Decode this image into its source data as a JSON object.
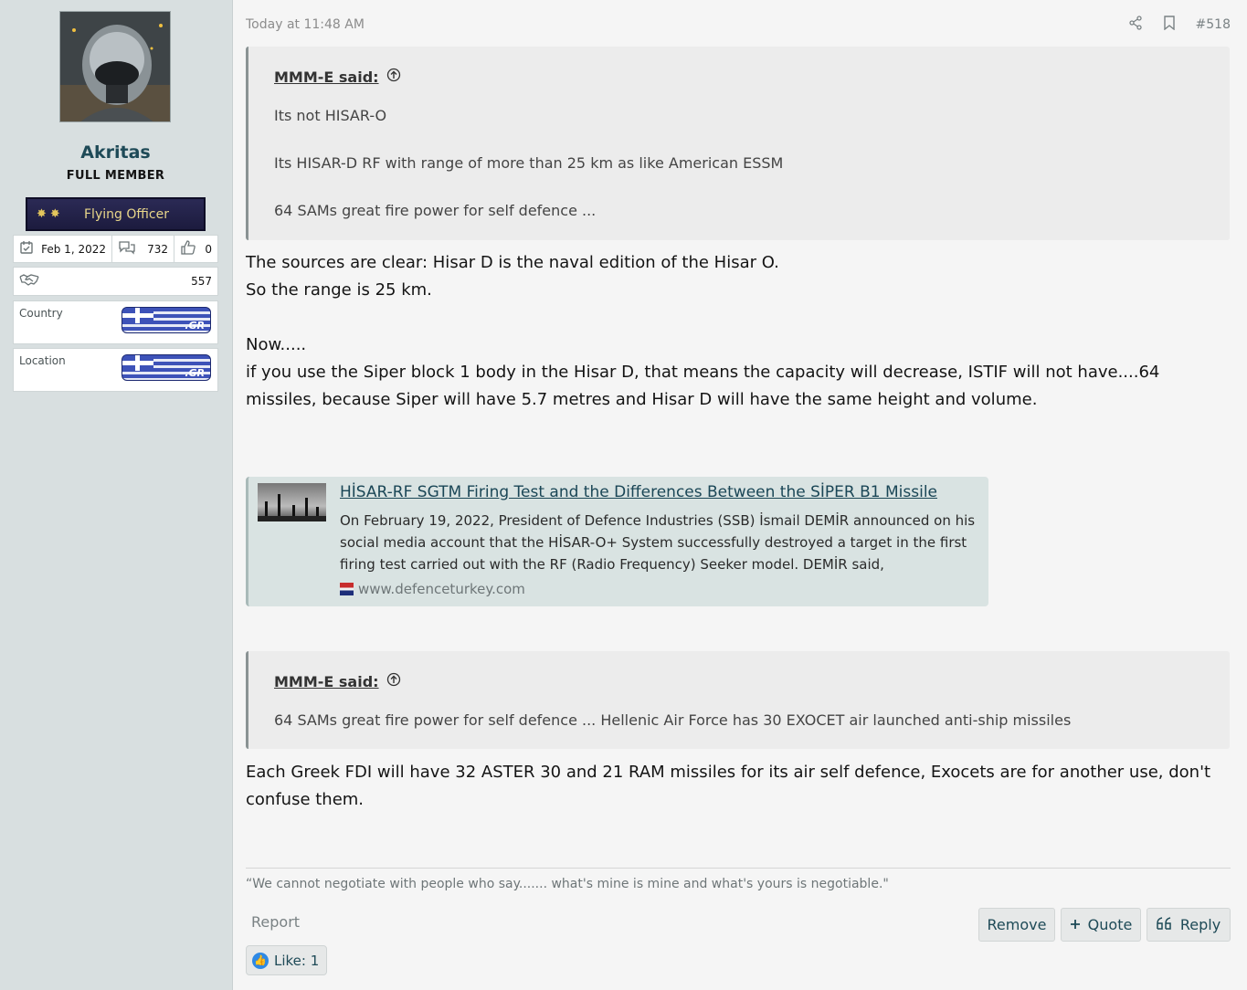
{
  "user": {
    "username": "Akritas",
    "title": "FULL MEMBER",
    "rank": "Flying Officer",
    "joined": "Feb 1, 2022",
    "messages": "732",
    "reactions": "0",
    "points": "557",
    "country_label": "Country",
    "location_label": "Location",
    "country_flag_text": ".GR",
    "location_flag_text": ".GR"
  },
  "post": {
    "time": "Today at 11:48 AM",
    "number": "#518"
  },
  "quote1": {
    "author": "MMM-E said:",
    "lines": [
      "Its not HISAR-O",
      "Its HISAR-D RF with range of more than 25 km as like American ESSM",
      "64 SAMs great fire power for self defence ..."
    ]
  },
  "body1": [
    "The sources are clear: Hisar D is the naval edition of the Hisar O.",
    "So the range is 25 km.",
    "Now.....",
    "if you use the Siper block 1 body in the Hisar D, that means the capacity will decrease, ISTIF will not have....64 missiles, because Siper will have 5.7 metres and Hisar D will have the same height and volume."
  ],
  "link_card": {
    "title": "HİSAR-RF SGTM Firing Test and the Differences Between the SİPER B1 Missile",
    "description": "On February 19, 2022, President of Defence Industries (SSB) İsmail DEMİR announced on his social media account that the HİSAR-O+ System successfully destroyed a target in the first firing test carried out with the RF (Radio Frequency) Seeker model. DEMİR said,",
    "domain": "www.defenceturkey.com"
  },
  "quote2": {
    "author": "MMM-E said:",
    "lines": [
      "64 SAMs great fire power for self defence ... Hellenic Air Force has 30 EXOCET air launched anti-ship missiles"
    ]
  },
  "body2": "Each Greek FDI will have 32 ASTER 30 and 21 RAM missiles for its air self defence, Exocets are for another use, don't confuse them.",
  "signature": "“We cannot negotiate with people who say....... what's mine is mine and what's yours is negotiable.\"",
  "actions": {
    "report": "Report",
    "remove": "Remove",
    "quote": "Quote",
    "reply": "Reply"
  },
  "reactions_bar": "Like: 1",
  "colors": {
    "accent": "#1e4a57",
    "sidebar_bg": "#d8dfe0",
    "quote_bg": "#ececec",
    "link_card_bg": "#d9e3e2"
  },
  "icons": [
    "calendar-icon",
    "messages-icon",
    "thumbs-up-icon",
    "handshake-icon",
    "share-icon",
    "bookmark-icon",
    "jump-arrow-icon",
    "plus-icon",
    "quote-mark-icon",
    "like-icon"
  ]
}
